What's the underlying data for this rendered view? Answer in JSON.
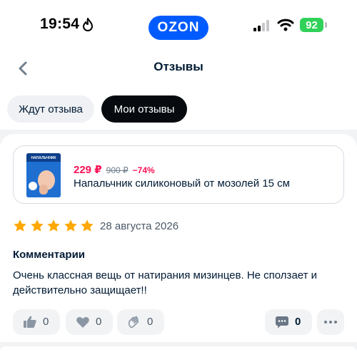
{
  "status_bar": {
    "time": "19:54",
    "battery": "92",
    "brand": "OZON"
  },
  "header": {
    "title": "Отзывы"
  },
  "tabs": [
    {
      "label": "Ждут отзыва",
      "active": false
    },
    {
      "label": "Мои отзывы",
      "active": true
    }
  ],
  "product": {
    "price": "229 ₽",
    "old_price": "900 ₽",
    "discount": "−74%",
    "name": "Напальчник силиконовый от мозолей 15 см",
    "image_label": "НАПАЛЬЧНИК"
  },
  "review": {
    "rating": 5,
    "date": "28 августа 2026",
    "comments_heading": "Комментарии",
    "text": "Очень классная вещь от натирания мизинцев. Не сползает и действительно защищает!!"
  },
  "actions": {
    "likes": "0",
    "hearts": "0",
    "claps": "0",
    "comments": "0"
  },
  "colors": {
    "brand": "#005bff",
    "price": "#f91155",
    "star": "#ffa800",
    "battery": "#30d158"
  }
}
